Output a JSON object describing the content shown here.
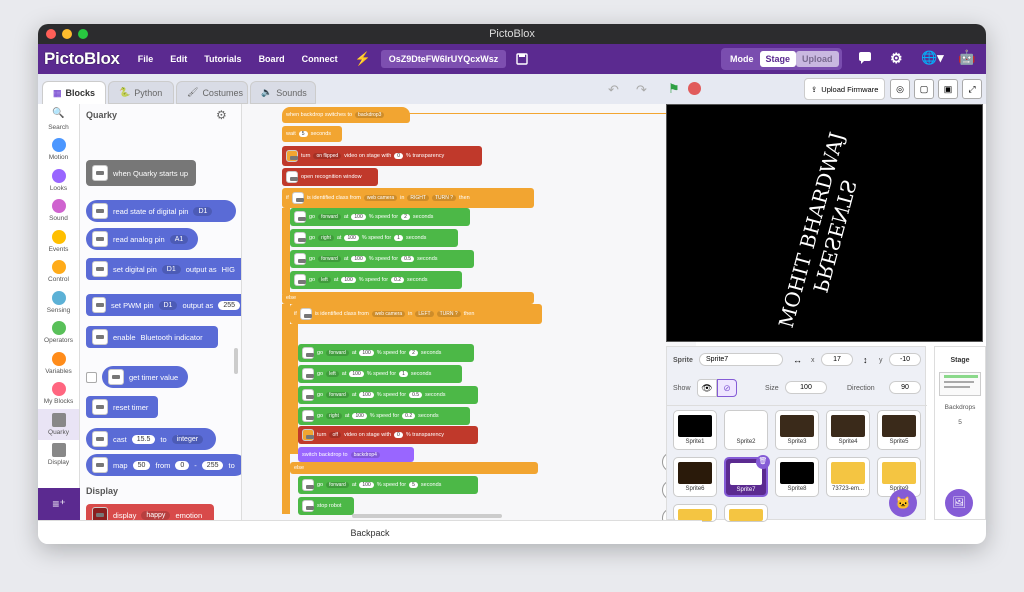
{
  "window": {
    "title": "PictoBlox"
  },
  "menubar": {
    "logo": "PictoBlox",
    "items": [
      "File",
      "Edit",
      "Tutorials",
      "Board",
      "Connect"
    ],
    "project_name": "OsZ9DteFW6IrUYQcxWsz",
    "mode_label": "Mode",
    "mode_stage": "Stage",
    "mode_upload": "Upload"
  },
  "tabs": {
    "blocks": "Blocks",
    "python": "Python",
    "costumes": "Costumes",
    "sounds": "Sounds"
  },
  "categories": [
    {
      "label": "Search",
      "color": "#4a90e2"
    },
    {
      "label": "Motion",
      "color": "#4c97ff"
    },
    {
      "label": "Looks",
      "color": "#9966ff"
    },
    {
      "label": "Sound",
      "color": "#cf63cf"
    },
    {
      "label": "Events",
      "color": "#ffbf00"
    },
    {
      "label": "Control",
      "color": "#ffab19"
    },
    {
      "label": "Sensing",
      "color": "#5cb1d6"
    },
    {
      "label": "Operators",
      "color": "#59c059"
    },
    {
      "label": "Variables",
      "color": "#ff8c1a"
    },
    {
      "label": "My Blocks",
      "color": "#ff6680"
    },
    {
      "label": "Quarky",
      "color": "#888888"
    },
    {
      "label": "Display",
      "color": "#888888"
    }
  ],
  "palette": {
    "header": "Quarky",
    "blocks": {
      "start": "when Quarky starts up",
      "read_digital": "read state of digital pin",
      "read_digital_pin": "D1",
      "read_analog": "read analog pin",
      "read_analog_pin": "A1",
      "set_digital": "set digital pin",
      "set_digital_pin": "D1",
      "set_digital_out": "output as",
      "set_digital_val": "HIG",
      "set_pwm": "set PWM pin",
      "set_pwm_pin": "D1",
      "set_pwm_out": "output as",
      "set_pwm_val": "255",
      "enable": "enable",
      "enable_opt": "Bluetooth indicator",
      "get_timer": "get timer value",
      "reset_timer": "reset timer",
      "cast": "cast",
      "cast_val": "15.5",
      "cast_to": "to",
      "cast_type": "integer",
      "map": "map",
      "map_val": "50",
      "map_from": "from",
      "map_a": "0",
      "map_dash": "-",
      "map_b": "255",
      "map_to": "to",
      "display_header": "Display",
      "display": "display",
      "display_emotion": "happy",
      "display_suffix": "emotion"
    }
  },
  "script": {
    "when_backdrop": "when backdrop switches to",
    "backdrop3": "backdrop3",
    "wait": "wait",
    "wait_val": "5",
    "seconds": "seconds",
    "turn": "turn",
    "on_flipped": "on flipped",
    "video_on_stage": "video on stage with",
    "transp0": "0",
    "transparency": "% transparency",
    "open_window": "open recognition window",
    "if": "if",
    "is_identified": "is identified class from",
    "web_camera": "web camera",
    "in": "in",
    "right_turn": "RIGHT",
    "turn_q": "TURN ?",
    "then": "then",
    "go": "go",
    "forward": "forward",
    "right": "right",
    "left": "left",
    "at": "at",
    "speed100": "100",
    "speed_for": "% speed for",
    "v2": "2",
    "v1": "1",
    "v05": "0.5",
    "v02": "0.2",
    "else": "else",
    "left_turn": "LEFT",
    "off": "off",
    "switch_backdrop": "switch backdrop to",
    "backdrop4": "backdrop4",
    "v5": "5",
    "stop_robot": "stop robot"
  },
  "stage": {
    "upload_firmware": "Upload Firmware",
    "canvas_line1": "MOHIT BHARDWAJ",
    "canvas_line2": "PRESENTS"
  },
  "sprite_panel": {
    "sprite_label": "Sprite",
    "sprite_name": "Sprite7",
    "x_label": "x",
    "x_val": "17",
    "y_label": "y",
    "y_val": "-10",
    "show_label": "Show",
    "size_label": "Size",
    "size_val": "100",
    "direction_label": "Direction",
    "direction_val": "90",
    "sprites": [
      "Sprite1",
      "Sprite2",
      "Sprite3",
      "Sprite4",
      "Sprite5",
      "Sprite6",
      "Sprite7",
      "Sprite8",
      "73723-em...",
      "Sprite9"
    ]
  },
  "stage_panel": {
    "title": "Stage",
    "backdrops_label": "Backdrops",
    "backdrops_count": "5"
  },
  "backpack": "Backpack",
  "colors": {
    "brand": "#5b2a90",
    "accent": "#855cd6"
  }
}
